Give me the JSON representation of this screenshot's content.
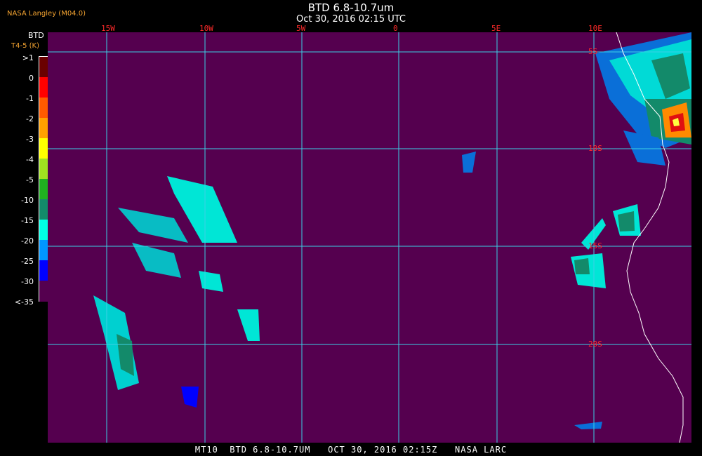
{
  "header": {
    "title": "BTD 6.8-10.7um",
    "date": "Oct 30, 2016 02:15 UTC",
    "source": "NASA Langley (M04.0)"
  },
  "legend": {
    "title": "BTD",
    "units": "T4-5 (K)",
    "labels": [
      ">1",
      "0",
      "-1",
      "-2",
      "-3",
      "-4",
      "-5",
      "-10",
      "-15",
      "-20",
      "-25",
      "-30",
      "<-35"
    ],
    "colors": [
      "#6a0000",
      "#ff0000",
      "#ff5a00",
      "#ffa000",
      "#ffff00",
      "#a0e020",
      "#20b020",
      "#138a6a",
      "#00ffe6",
      "#0096ff",
      "#0000ff",
      "#55004f"
    ]
  },
  "grid": {
    "lon_labels": [
      "15W",
      "10W",
      "5W",
      "0",
      "5E",
      "10E"
    ],
    "lat_labels": [
      "5S",
      "10S",
      "15S",
      "20S"
    ],
    "line_color": "#3cd0e6",
    "label_color": "#ff2a2a"
  },
  "map": {
    "background": "#55004f",
    "coast_color": "#ffffff"
  },
  "footer": {
    "text": "MT10  BTD 6.8-10.7UM   OCT 30, 2016 02:15Z   NASA LARC"
  }
}
